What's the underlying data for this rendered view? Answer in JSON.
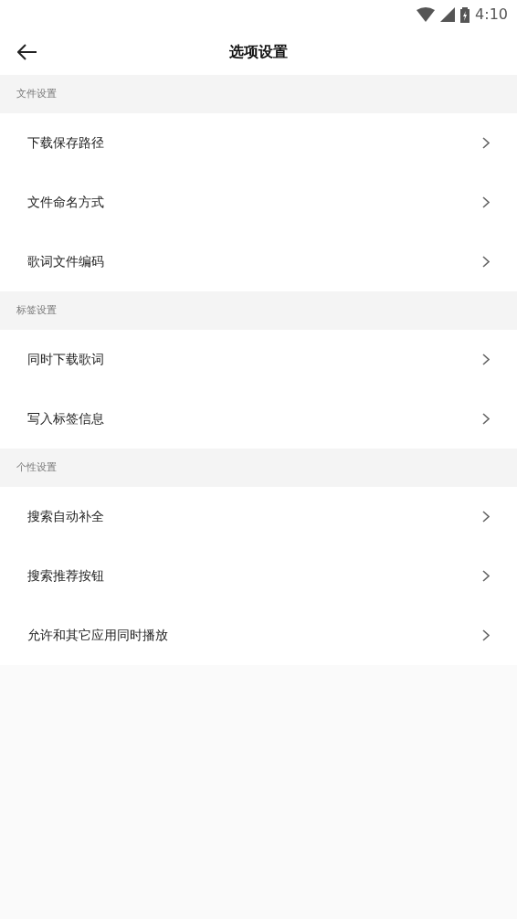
{
  "status_bar": {
    "time": "4:10"
  },
  "header": {
    "title": "选项设置"
  },
  "sections": [
    {
      "title": "文件设置",
      "items": [
        {
          "label": "下载保存路径"
        },
        {
          "label": "文件命名方式"
        },
        {
          "label": "歌词文件编码"
        }
      ]
    },
    {
      "title": "标签设置",
      "items": [
        {
          "label": "同时下载歌词"
        },
        {
          "label": "写入标签信息"
        }
      ]
    },
    {
      "title": "个性设置",
      "items": [
        {
          "label": "搜索自动补全"
        },
        {
          "label": "搜索推荐按钮"
        },
        {
          "label": "允许和其它应用同时播放"
        }
      ]
    }
  ]
}
